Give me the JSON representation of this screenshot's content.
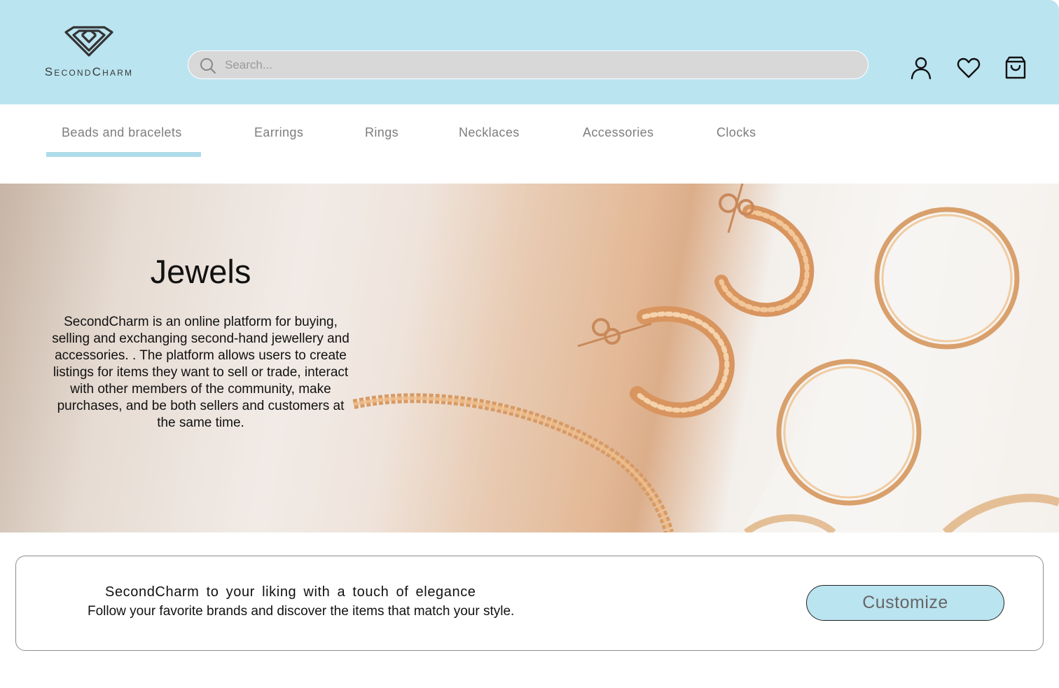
{
  "brand": {
    "name": "SecondCharm"
  },
  "search": {
    "placeholder": "Search..."
  },
  "header_icons": [
    "user-icon",
    "heart-icon",
    "shopping-bag-icon"
  ],
  "nav": {
    "items": [
      {
        "label": "Beads  and  bracelets",
        "active": true
      },
      {
        "label": "Earrings"
      },
      {
        "label": "Rings"
      },
      {
        "label": "Necklaces"
      },
      {
        "label": "Accessories"
      },
      {
        "label": "Clocks"
      }
    ]
  },
  "hero": {
    "title": "Jewels",
    "description": "SecondCharm is an online platform for buying, selling and exchanging second-hand jewellery and accessories. . The platform allows users to create listings for items they want to sell or trade, interact with other members of the community, make purchases, and be both sellers and customers at the same time."
  },
  "promo": {
    "title": "SecondCharm to your liking with a touch of elegance",
    "subtitle": "Follow your favorite brands and discover the items that match your style.",
    "button_label": "Customize"
  },
  "colors": {
    "header_bg": "#bae4f0",
    "accent": "#aedbe9",
    "search_bg": "#d8d8d8",
    "nav_text": "#7d7d7d"
  }
}
